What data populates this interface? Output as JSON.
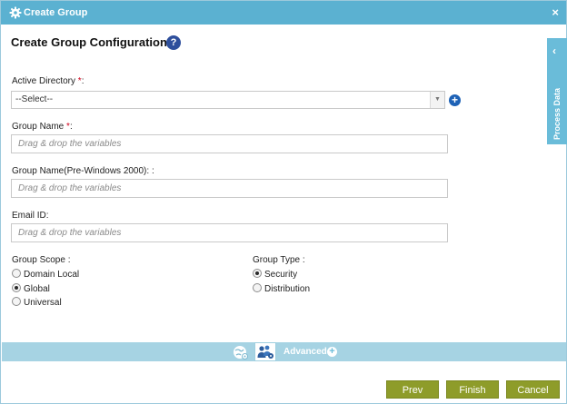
{
  "window": {
    "title": "Create Group",
    "close_glyph": "×"
  },
  "heading": "Create Group Configuration",
  "help_glyph": "?",
  "active_directory": {
    "label": "Active Directory",
    "required_mark": "*",
    "colon": ":",
    "value": "--Select--"
  },
  "group_name": {
    "label": "Group Name",
    "required_mark": "*",
    "colon": ":",
    "placeholder": "Drag & drop the variables"
  },
  "group_name_pre2000": {
    "label": "Group Name(Pre-Windows 2000): :",
    "placeholder": "Drag & drop the variables"
  },
  "email_id": {
    "label": "Email ID:",
    "placeholder": "Drag & drop the variables"
  },
  "group_scope": {
    "label": "Group Scope :",
    "options": [
      {
        "label": "Domain Local",
        "selected": false
      },
      {
        "label": "Global",
        "selected": true
      },
      {
        "label": "Universal",
        "selected": false
      }
    ]
  },
  "group_type": {
    "label": "Group Type :",
    "options": [
      {
        "label": "Security",
        "selected": true
      },
      {
        "label": "Distribution",
        "selected": false
      }
    ]
  },
  "side_panel": {
    "label": "Process Data"
  },
  "advanced": {
    "label": "Advanced"
  },
  "buttons": {
    "prev": "Prev",
    "finish": "Finish",
    "cancel": "Cancel"
  },
  "colors": {
    "titlebar": "#5bb1d1",
    "button": "#8e9c2a",
    "advanced_bar": "#a6d3e3",
    "required": "#d0021b"
  }
}
